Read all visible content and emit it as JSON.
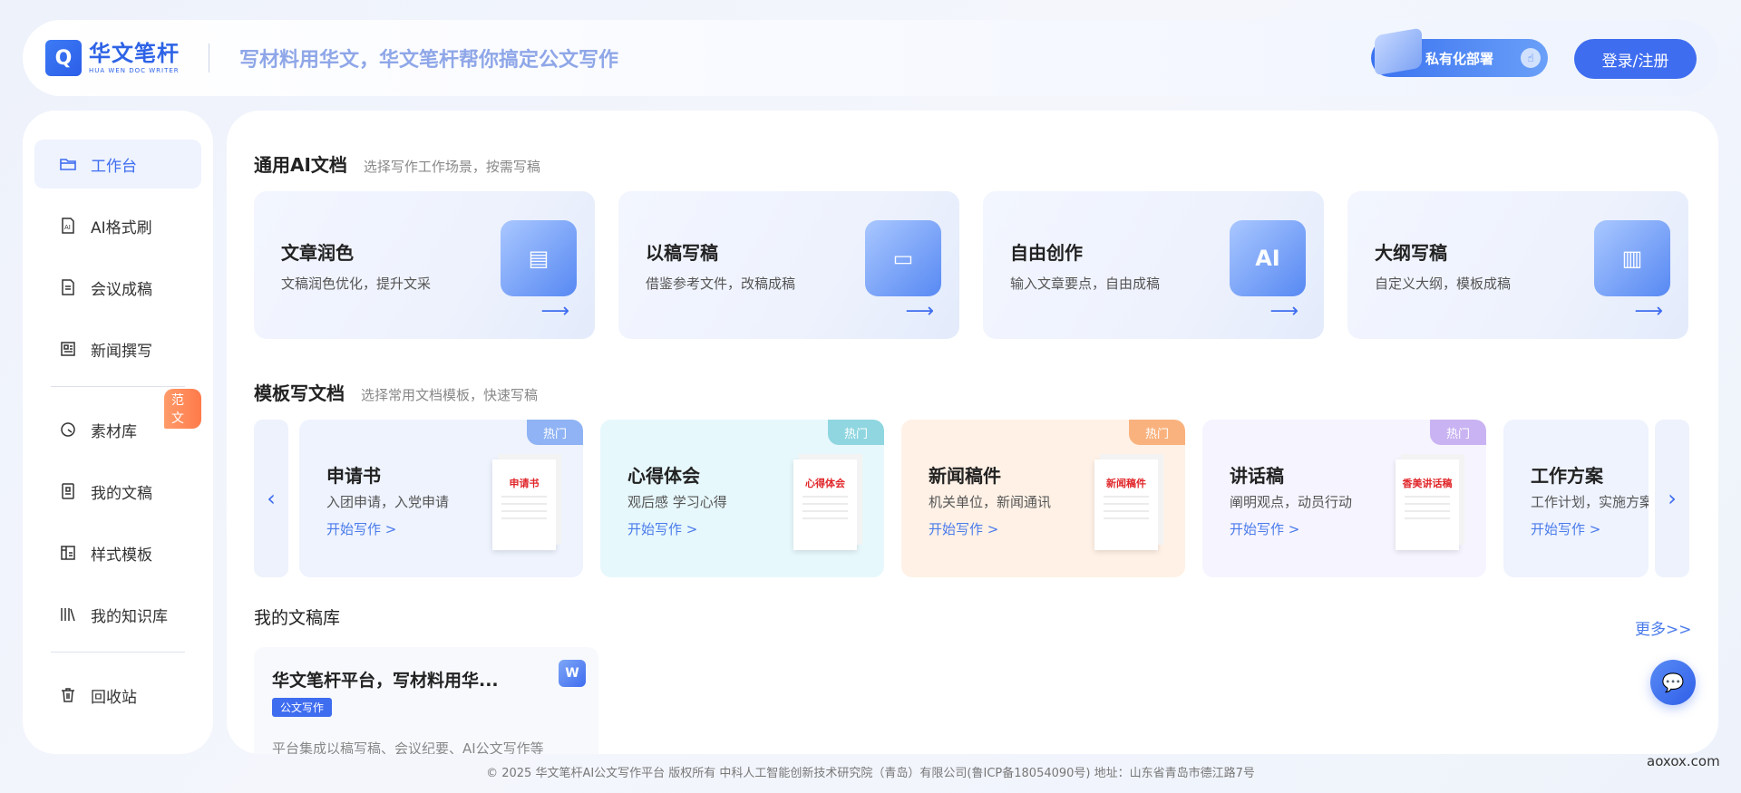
{
  "header": {
    "logo_cn": "华文笔杆",
    "logo_en": "HUA WEN DOC WRITER",
    "slogan": "写材料用华文，华文笔杆帮你搞定公文写作",
    "private_deploy": "私有化部署",
    "login": "登录/注册"
  },
  "sidebar": {
    "items": [
      {
        "label": "工作台",
        "icon": "folder-icon",
        "active": true
      },
      {
        "label": "AI格式刷",
        "icon": "ai-doc-icon"
      },
      {
        "label": "会议成稿",
        "icon": "document-icon"
      },
      {
        "label": "新闻撰写",
        "icon": "news-icon"
      },
      {
        "label": "素材库",
        "icon": "clock-icon",
        "badge": "范文"
      },
      {
        "label": "我的文稿",
        "icon": "notebook-icon"
      },
      {
        "label": "样式模板",
        "icon": "template-icon"
      },
      {
        "label": "我的知识库",
        "icon": "books-icon"
      },
      {
        "label": "回收站",
        "icon": "trash-icon"
      }
    ]
  },
  "general": {
    "title": "通用AI文档",
    "subtitle": "选择写作工作场景，按需写稿",
    "cards": [
      {
        "title": "文章润色",
        "desc": "文稿润色优化，提升文采"
      },
      {
        "title": "以稿写稿",
        "desc": "借鉴参考文件，改稿成稿"
      },
      {
        "title": "自由创作",
        "desc": "输入文章要点，自由成稿"
      },
      {
        "title": "大纲写稿",
        "desc": "自定义大纲，模板成稿"
      }
    ],
    "arrow": "⟶"
  },
  "templates": {
    "title": "模板写文档",
    "subtitle": "选择常用文档模板，快速写稿",
    "start_label": "开始写作 >",
    "hot_label": "热门",
    "prev": "‹",
    "next": "›",
    "cards": [
      {
        "title": "申请书",
        "desc": "入团申请，入党申请",
        "doc": "申请书",
        "hot_color": "#8fb3f4",
        "bg": "#eef3fe"
      },
      {
        "title": "心得体会",
        "desc": "观后感 学习心得",
        "doc": "心得体会",
        "hot_color": "#8fd6e0",
        "bg": "#e7f8fc"
      },
      {
        "title": "新闻稿件",
        "desc": "机关单位，新闻通讯",
        "doc": "新闻稿件",
        "hot_color": "#f9b27e",
        "bg": "#fff1e6"
      },
      {
        "title": "讲话稿",
        "desc": "阐明观点，动员行动",
        "doc": "香美讲话稿",
        "hot_color": "#c9b3f2",
        "bg": "#f6f4fe"
      },
      {
        "title": "工作方案",
        "desc": "工作计划，实施方案",
        "doc": "",
        "hot_color": "",
        "bg": "#eef3fe"
      }
    ]
  },
  "library": {
    "title": "我的文稿库",
    "more": "更多>>",
    "doc": {
      "title": "华文笔杆平台，写材料用华...",
      "tag": "公文写作",
      "summary": "平台集成以稿写稿、会议纪要、AI公文写作等",
      "file_icon": "W"
    }
  },
  "footer": "© 2025 华文笔杆AI公文写作平台 版权所有 中科人工智能创新技术研究院（青岛）有限公司(鲁ICP备18054090号) 地址：山东省青岛市德江路7号",
  "watermark": "aoxox.com"
}
